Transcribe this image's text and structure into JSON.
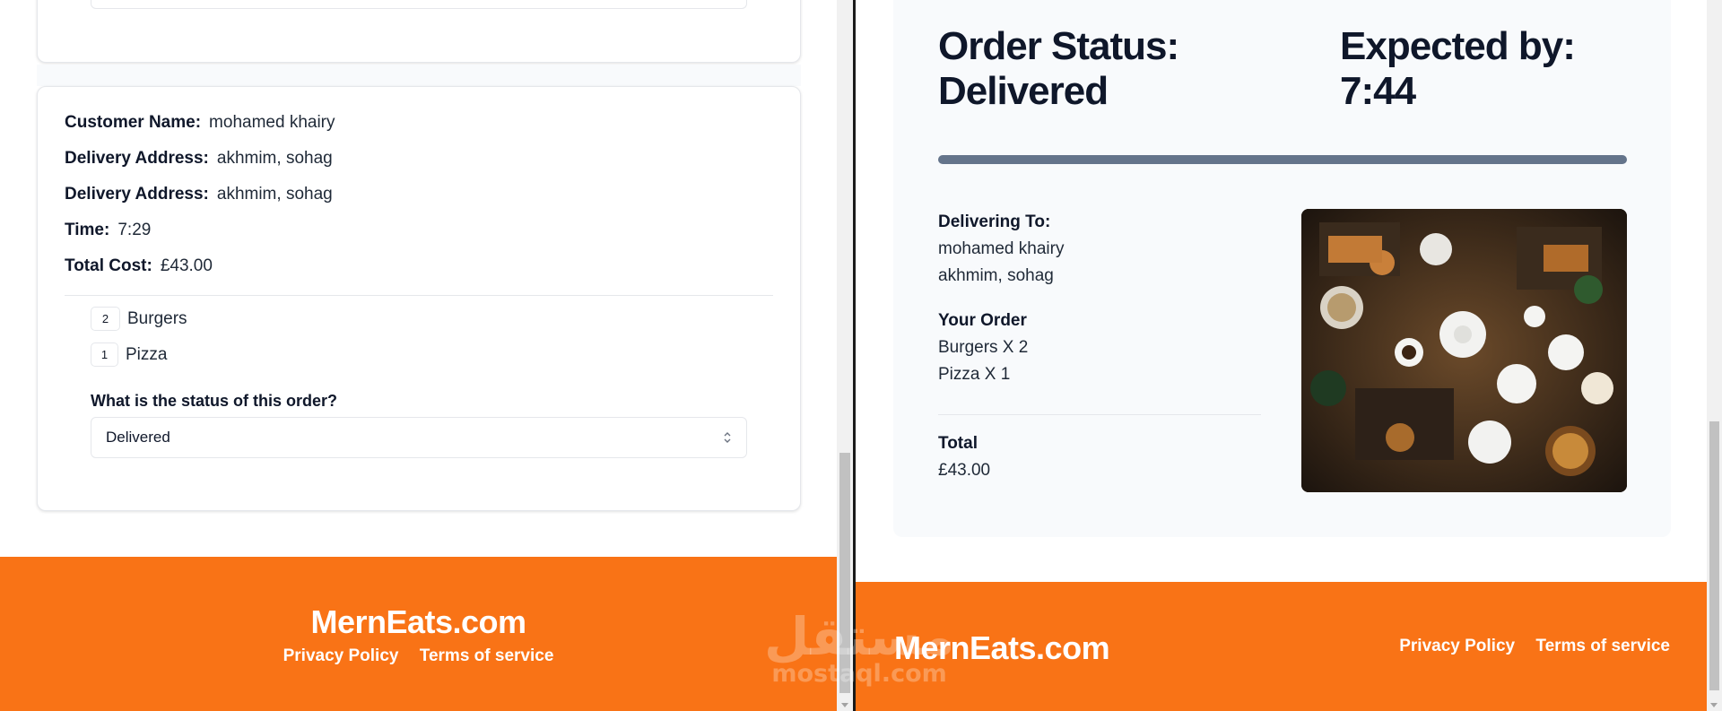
{
  "admin": {
    "customer_label": "Customer Name:",
    "customer_value": "mohamed khairy",
    "address_label": "Delivery Address:",
    "address_value": "akhmim, sohag",
    "address2_label": "Delivery Address:",
    "address2_value": "akhmim, sohag",
    "time_label": "Time:",
    "time_value": "7:29",
    "total_label": "Total Cost:",
    "total_value": "£43.00",
    "items": [
      {
        "qty": "2",
        "name": "Burgers"
      },
      {
        "qty": "1",
        "name": "Pizza"
      }
    ],
    "status_question": "What is the status of this order?",
    "status_value": "Delivered"
  },
  "order": {
    "status_title_line1": "Order Status:",
    "status_title_line2": "Delivered",
    "expected_line1": "Expected by:",
    "expected_line2": "7:44",
    "progress_percent": 100,
    "delivering_to_label": "Delivering To:",
    "delivering_name": "mohamed khairy",
    "delivering_address": "akhmim, sohag",
    "your_order_label": "Your Order",
    "order_lines": [
      "Burgers X 2",
      "Pizza X 1"
    ],
    "total_label": "Total",
    "total_value": "£43.00",
    "image_icon": "food-photo"
  },
  "footer": {
    "brand": "MernEats.com",
    "privacy": "Privacy Policy",
    "terms": "Terms of service"
  },
  "watermark": {
    "arabic": "مستقل",
    "latin": "mostaql.com"
  },
  "colors": {
    "accent": "#f97316",
    "panel": "#f8fafc",
    "progress": "#64748b"
  }
}
